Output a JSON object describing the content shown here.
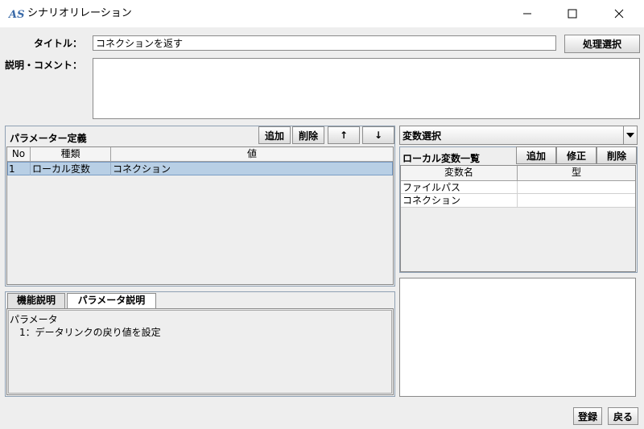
{
  "window": {
    "title": "シナリオリレーション",
    "logo_text": "AS"
  },
  "form": {
    "title_label": "タイトル：",
    "title_value": "コネクションを返す",
    "process_select_button": "処理選択",
    "desc_label": "説明・コメント：",
    "desc_value": ""
  },
  "params": {
    "heading": "パラメーター定義",
    "add_button": "追加",
    "delete_button": "削除",
    "up_button": "↑",
    "down_button": "↓",
    "columns": [
      "No",
      "種類",
      "値"
    ],
    "rows": [
      {
        "no": "1",
        "kind": "ローカル変数",
        "value": "コネクション"
      }
    ]
  },
  "variables": {
    "select_label": "変数選択",
    "local_heading": "ローカル変数一覧",
    "add_button": "追加",
    "modify_button": "修正",
    "delete_button": "削除",
    "columns": [
      "変数名",
      "型"
    ],
    "rows": [
      {
        "name": "ファイルパス",
        "type": ""
      },
      {
        "name": "コネクション",
        "type": ""
      }
    ]
  },
  "tabs": {
    "items": [
      "機能説明",
      "パラメータ説明"
    ],
    "active": 1,
    "content_lines": [
      "パラメータ",
      "　1：データリンクの戻り値を設定"
    ]
  },
  "footer": {
    "register_button": "登録",
    "back_button": "戻る"
  },
  "colors": {
    "selection": "#b8cfe5",
    "panel_border": "#8ea0b3",
    "background": "#eeeeee"
  }
}
